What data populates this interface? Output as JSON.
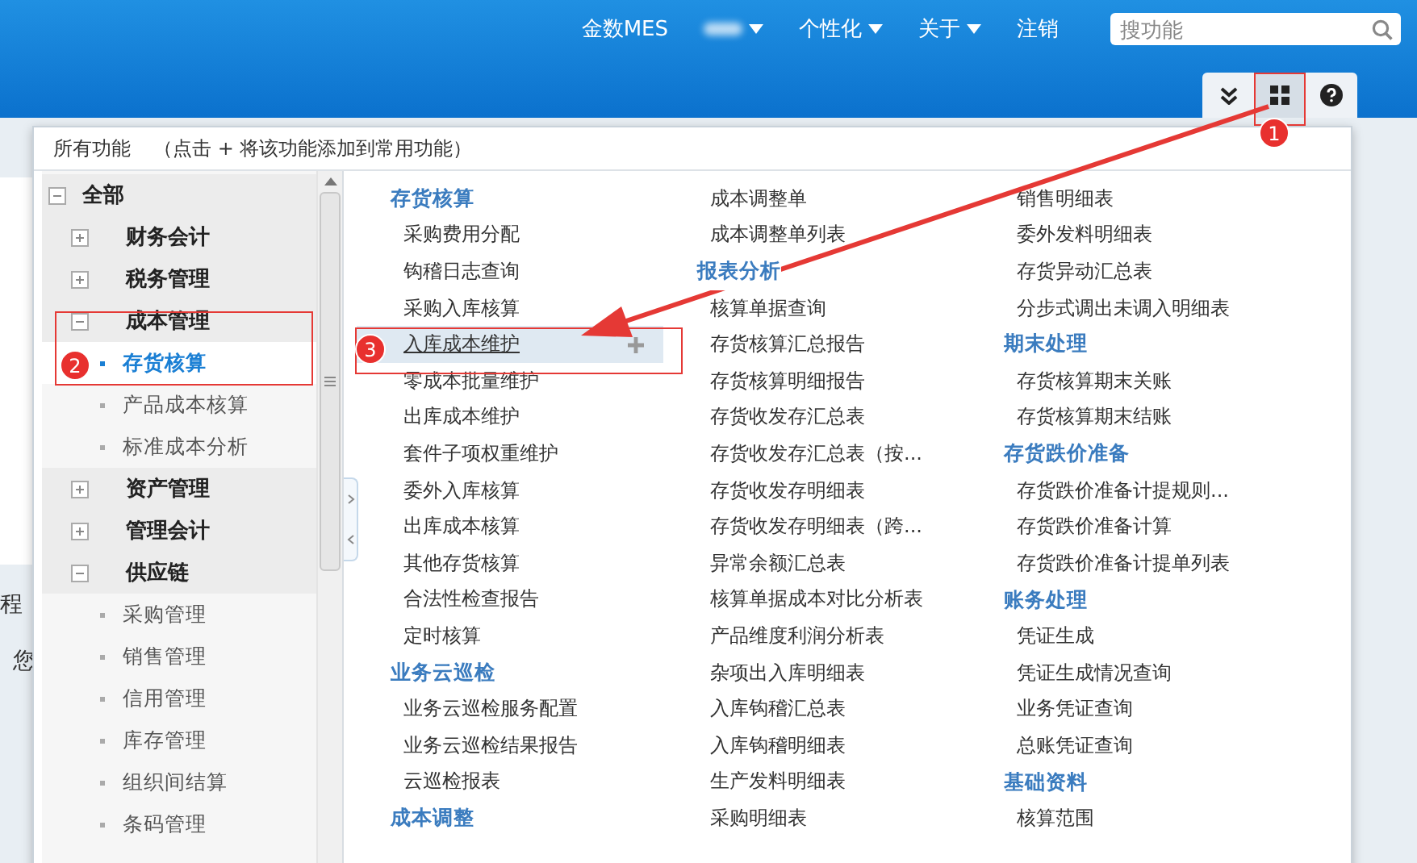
{
  "header": {
    "brand": "金数MES",
    "menus": [
      {
        "label": "个性化",
        "dropdown": true
      },
      {
        "label": "关于",
        "dropdown": true
      },
      {
        "label": "注销",
        "dropdown": false
      }
    ],
    "search": {
      "placeholder": "搜功能"
    }
  },
  "toolbar": {
    "buttons": [
      {
        "kind": "collapse",
        "selected": false
      },
      {
        "kind": "grid",
        "selected": true
      },
      {
        "kind": "help",
        "selected": false
      }
    ]
  },
  "background": {
    "fragments": [
      "程",
      "您"
    ]
  },
  "panel": {
    "title": "所有功能",
    "hint": "（点击 + 将该功能添加到常用功能）",
    "tree": [
      {
        "label": "全部",
        "expanded": true,
        "selected": false,
        "children": [
          {
            "label": "财务会计",
            "expanded": false,
            "selected": false
          },
          {
            "label": "税务管理",
            "expanded": false,
            "selected": false
          },
          {
            "label": "成本管理",
            "expanded": true,
            "selected": false,
            "children": [
              {
                "label": "存货核算",
                "selected": true
              },
              {
                "label": "产品成本核算",
                "selected": false
              },
              {
                "label": "标准成本分析",
                "selected": false
              }
            ]
          },
          {
            "label": "资产管理",
            "expanded": false,
            "selected": false
          },
          {
            "label": "管理会计",
            "expanded": false,
            "selected": false
          },
          {
            "label": "供应链",
            "expanded": true,
            "selected": false,
            "children": [
              {
                "label": "采购管理",
                "selected": false
              },
              {
                "label": "销售管理",
                "selected": false
              },
              {
                "label": "信用管理",
                "selected": false
              },
              {
                "label": "库存管理",
                "selected": false
              },
              {
                "label": "组织间结算",
                "selected": false
              },
              {
                "label": "条码管理",
                "selected": false
              }
            ]
          }
        ]
      }
    ],
    "columns": [
      [
        {
          "kind": "heading",
          "label": "存货核算"
        },
        {
          "kind": "item",
          "label": "采购费用分配",
          "hovered": false
        },
        {
          "kind": "item",
          "label": "钩稽日志查询",
          "hovered": false
        },
        {
          "kind": "item",
          "label": "采购入库核算",
          "hovered": false
        },
        {
          "kind": "item",
          "label": "入库成本维护",
          "hovered": true
        },
        {
          "kind": "item",
          "label": "零成本批量维护",
          "hovered": false
        },
        {
          "kind": "item",
          "label": "出库成本维护",
          "hovered": false
        },
        {
          "kind": "item",
          "label": "套件子项权重维护",
          "hovered": false
        },
        {
          "kind": "item",
          "label": "委外入库核算",
          "hovered": false
        },
        {
          "kind": "item",
          "label": "出库成本核算",
          "hovered": false
        },
        {
          "kind": "item",
          "label": "其他存货核算",
          "hovered": false
        },
        {
          "kind": "item",
          "label": "合法性检查报告",
          "hovered": false
        },
        {
          "kind": "item",
          "label": "定时核算",
          "hovered": false
        },
        {
          "kind": "heading",
          "label": "业务云巡检"
        },
        {
          "kind": "item",
          "label": "业务云巡检服务配置",
          "hovered": false
        },
        {
          "kind": "item",
          "label": "业务云巡检结果报告",
          "hovered": false
        },
        {
          "kind": "item",
          "label": "云巡检报表",
          "hovered": false
        },
        {
          "kind": "heading",
          "label": "成本调整"
        }
      ],
      [
        {
          "kind": "item",
          "label": "成本调整单",
          "hovered": false
        },
        {
          "kind": "item",
          "label": "成本调整单列表",
          "hovered": false
        },
        {
          "kind": "heading",
          "label": "报表分析"
        },
        {
          "kind": "item",
          "label": "核算单据查询",
          "hovered": false
        },
        {
          "kind": "item",
          "label": "存货核算汇总报告",
          "hovered": false
        },
        {
          "kind": "item",
          "label": "存货核算明细报告",
          "hovered": false
        },
        {
          "kind": "item",
          "label": "存货收发存汇总表",
          "hovered": false
        },
        {
          "kind": "item",
          "label": "存货收发存汇总表（按...",
          "hovered": false
        },
        {
          "kind": "item",
          "label": "存货收发存明细表",
          "hovered": false
        },
        {
          "kind": "item",
          "label": "存货收发存明细表（跨...",
          "hovered": false
        },
        {
          "kind": "item",
          "label": "异常余额汇总表",
          "hovered": false
        },
        {
          "kind": "item",
          "label": "核算单据成本对比分析表",
          "hovered": false
        },
        {
          "kind": "item",
          "label": "产品维度利润分析表",
          "hovered": false
        },
        {
          "kind": "item",
          "label": "杂项出入库明细表",
          "hovered": false
        },
        {
          "kind": "item",
          "label": "入库钩稽汇总表",
          "hovered": false
        },
        {
          "kind": "item",
          "label": "入库钩稽明细表",
          "hovered": false
        },
        {
          "kind": "item",
          "label": "生产发料明细表",
          "hovered": false
        },
        {
          "kind": "item",
          "label": "采购明细表",
          "hovered": false
        }
      ],
      [
        {
          "kind": "item",
          "label": "销售明细表",
          "hovered": false
        },
        {
          "kind": "item",
          "label": "委外发料明细表",
          "hovered": false
        },
        {
          "kind": "item",
          "label": "存货异动汇总表",
          "hovered": false
        },
        {
          "kind": "item",
          "label": "分步式调出未调入明细表",
          "hovered": false
        },
        {
          "kind": "heading",
          "label": "期末处理"
        },
        {
          "kind": "item",
          "label": "存货核算期末关账",
          "hovered": false
        },
        {
          "kind": "item",
          "label": "存货核算期末结账",
          "hovered": false
        },
        {
          "kind": "heading",
          "label": "存货跌价准备"
        },
        {
          "kind": "item",
          "label": "存货跌价准备计提规则...",
          "hovered": false
        },
        {
          "kind": "item",
          "label": "存货跌价准备计算",
          "hovered": false
        },
        {
          "kind": "item",
          "label": "存货跌价准备计提单列表",
          "hovered": false
        },
        {
          "kind": "heading",
          "label": "账务处理"
        },
        {
          "kind": "item",
          "label": "凭证生成",
          "hovered": false
        },
        {
          "kind": "item",
          "label": "凭证生成情况查询",
          "hovered": false
        },
        {
          "kind": "item",
          "label": "业务凭证查询",
          "hovered": false
        },
        {
          "kind": "item",
          "label": "总账凭证查询",
          "hovered": false
        },
        {
          "kind": "heading",
          "label": "基础资料"
        },
        {
          "kind": "item",
          "label": "核算范围",
          "hovered": false
        }
      ]
    ]
  },
  "annotations": [
    {
      "label": "1"
    },
    {
      "label": "2"
    },
    {
      "label": "3"
    }
  ]
}
